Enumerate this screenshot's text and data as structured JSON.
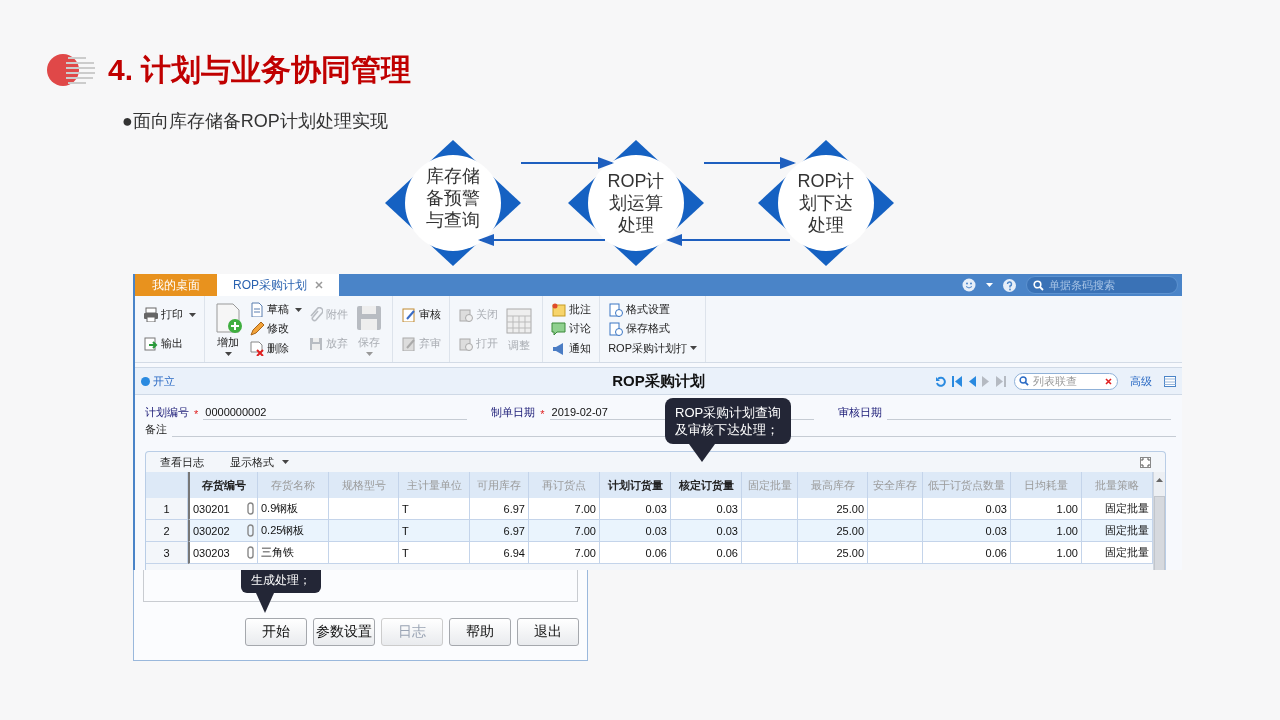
{
  "slide": {
    "title": "4. 计划与业务协同管理",
    "bullet": "●面向库存储备ROP计划处理实现"
  },
  "flow": {
    "nodes": [
      {
        "lines": [
          "库存储",
          "备预警",
          "与查询"
        ]
      },
      {
        "lines": [
          "ROP计",
          "划运算",
          "处理"
        ]
      },
      {
        "lines": [
          "ROP计",
          "划下达",
          "处理"
        ]
      }
    ]
  },
  "app": {
    "tabs": [
      {
        "label": "我的桌面",
        "selected": false
      },
      {
        "label": "ROP采购计划",
        "selected": true
      }
    ],
    "search": {
      "placeholder": "单据条码搜索"
    },
    "toolbar": [
      [
        [
          {
            "label": "打印",
            "kind": "small",
            "disabled": false,
            "caret": true
          },
          {
            "label": "输出",
            "kind": "small",
            "disabled": false,
            "caret": false
          }
        ]
      ],
      [
        [
          {
            "label": "增加",
            "kind": "large",
            "disabled": false,
            "caret": true
          }
        ],
        [
          {
            "label": "草稿",
            "kind": "small",
            "disabled": false,
            "caret": true
          },
          {
            "label": "修改",
            "kind": "small",
            "disabled": false,
            "caret": false
          },
          {
            "label": "删除",
            "kind": "small",
            "disabled": false,
            "caret": false
          }
        ],
        [
          {
            "label": "附件",
            "kind": "small",
            "disabled": true,
            "caret": false
          },
          {
            "label": "放弃",
            "kind": "small",
            "disabled": true,
            "caret": false
          }
        ],
        [
          {
            "label": "保存",
            "kind": "large",
            "disabled": true,
            "caret": true
          }
        ]
      ],
      [
        [
          {
            "label": "审核",
            "kind": "small",
            "disabled": false,
            "caret": false
          },
          {
            "label": "弃审",
            "kind": "small",
            "disabled": true,
            "caret": false
          }
        ]
      ],
      [
        [
          {
            "label": "关闭",
            "kind": "small",
            "disabled": true,
            "caret": false
          },
          {
            "label": "打开",
            "kind": "small",
            "disabled": true,
            "caret": false
          }
        ],
        [
          {
            "label": "调整",
            "kind": "large",
            "disabled": true,
            "caret": false
          }
        ]
      ],
      [
        [
          {
            "label": "批注",
            "kind": "small",
            "disabled": false,
            "caret": false
          },
          {
            "label": "讨论",
            "kind": "small",
            "disabled": false,
            "caret": false
          },
          {
            "label": "通知",
            "kind": "small",
            "disabled": false,
            "caret": false
          }
        ]
      ],
      [
        [
          {
            "label": "格式设置",
            "kind": "small",
            "disabled": false,
            "caret": false
          },
          {
            "label": "保存格式",
            "kind": "small",
            "disabled": false,
            "caret": false
          },
          {
            "label": "ROP采购计划打",
            "kind": "menu",
            "disabled": false,
            "caret": true
          }
        ]
      ]
    ],
    "status": "开立",
    "title": "ROP采购计划",
    "filter": {
      "placeholder": "列表联查"
    },
    "advanced": "高级",
    "form": [
      [
        {
          "label": "计划编号",
          "mark": "*",
          "value": "0000000002"
        },
        {
          "label": "制单日期",
          "mark": "*",
          "value": "2019-02-07"
        },
        {
          "label": "审核日期"
        }
      ],
      [
        {
          "label": "备注"
        }
      ]
    ],
    "grid": {
      "actions": [
        {
          "label": "查看日志",
          "caret": false
        },
        {
          "label": "显示格式",
          "caret": true
        }
      ],
      "columns": [
        {
          "label": "存货编号",
          "bold": true
        },
        {
          "label": "存货名称",
          "bold": false
        },
        {
          "label": "规格型号",
          "bold": false
        },
        {
          "label": "主计量单位",
          "bold": false
        },
        {
          "label": "可用库存",
          "bold": false
        },
        {
          "label": "再订货点",
          "bold": false
        },
        {
          "label": "计划订货量",
          "bold": true
        },
        {
          "label": "核定订货量",
          "bold": true
        },
        {
          "label": "固定批量",
          "bold": false
        },
        {
          "label": "最高库存",
          "bold": false
        },
        {
          "label": "安全库存",
          "bold": false
        },
        {
          "label": "低于订货点数量",
          "bold": false
        },
        {
          "label": "日均耗量",
          "bold": false
        },
        {
          "label": "批量策略",
          "bold": false
        }
      ],
      "rows": [
        {
          "number": "1",
          "attachment": true,
          "cells": [
            "030201",
            "0.9钢板",
            "",
            "T",
            "6.97",
            "7.00",
            "0.03",
            "0.03",
            "",
            "25.00",
            "",
            "0.03",
            "1.00",
            "固定批量"
          ]
        },
        {
          "number": "2",
          "attachment": true,
          "cells": [
            "030202",
            "0.25钢板",
            "",
            "T",
            "6.97",
            "7.00",
            "0.03",
            "0.03",
            "",
            "25.00",
            "",
            "0.03",
            "1.00",
            "固定批量"
          ]
        },
        {
          "number": "3",
          "attachment": true,
          "cells": [
            "030203",
            "三角铁",
            "",
            "T",
            "6.94",
            "7.00",
            "0.06",
            "0.06",
            "",
            "25.00",
            "",
            "0.06",
            "1.00",
            "固定批量"
          ]
        }
      ]
    },
    "callout": {
      "lines": [
        "ROP采购计划查询",
        "及审核下达处理；"
      ]
    }
  },
  "dialog": {
    "callout": "生成处理；",
    "buttons": [
      {
        "label": "开始",
        "disabled": false
      },
      {
        "label": "参数设置",
        "disabled": false
      },
      {
        "label": "日志",
        "disabled": true
      },
      {
        "label": "帮助",
        "disabled": false
      },
      {
        "label": "退出",
        "disabled": false
      }
    ]
  }
}
